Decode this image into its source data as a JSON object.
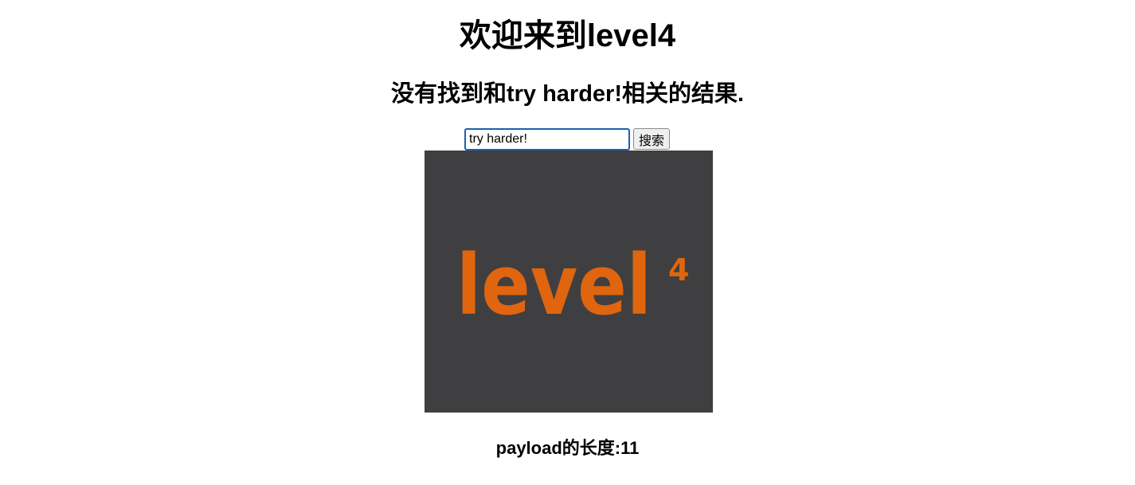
{
  "page": {
    "title": "欢迎来到level4",
    "result_message": "没有找到和try harder!相关的结果.",
    "payload_length_text": "payload的长度:11"
  },
  "search": {
    "input_value": "try harder!",
    "button_label": "搜索"
  },
  "logo": {
    "text": "level",
    "superscript": "4",
    "background_color": "#3f3f41",
    "text_color": "#e0650e"
  }
}
